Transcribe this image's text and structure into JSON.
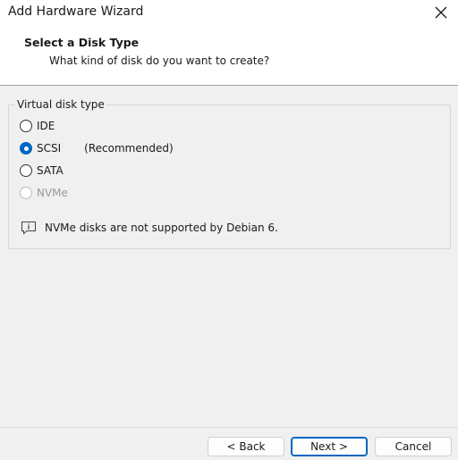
{
  "window": {
    "title": "Add Hardware Wizard",
    "close_icon": "close-icon"
  },
  "header": {
    "title": "Select a Disk Type",
    "subtitle": "What kind of disk do you want to create?"
  },
  "disk_type_group": {
    "legend": "Virtual disk type",
    "options": [
      {
        "label": "IDE",
        "selected": false,
        "enabled": true,
        "note": ""
      },
      {
        "label": "SCSI",
        "selected": true,
        "enabled": true,
        "note": "(Recommended)"
      },
      {
        "label": "SATA",
        "selected": false,
        "enabled": true,
        "note": ""
      },
      {
        "label": "NVMe",
        "selected": false,
        "enabled": false,
        "note": ""
      }
    ],
    "info_icon": "info-icon",
    "info_text": "NVMe disks are not supported by Debian 6."
  },
  "footer": {
    "back_label": "< Back",
    "next_label": "Next >",
    "cancel_label": "Cancel"
  },
  "colors": {
    "accent": "#0067c0",
    "background": "#f0f0f0"
  }
}
